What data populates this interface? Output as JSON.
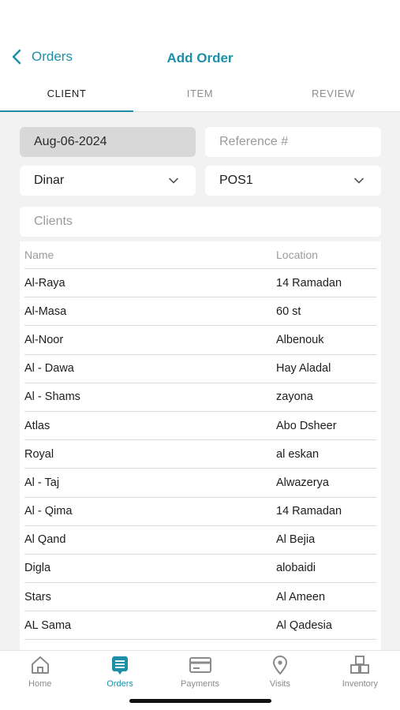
{
  "nav": {
    "back_label": "Orders",
    "title": "Add Order"
  },
  "tabs": [
    "CLIENT",
    "ITEM",
    "REVIEW"
  ],
  "form": {
    "date": "Aug-06-2024",
    "reference_placeholder": "Reference #",
    "currency": "Dinar",
    "pos": "POS1",
    "clients_placeholder": "Clients"
  },
  "table": {
    "headers": {
      "name": "Name",
      "location": "Location"
    },
    "rows": [
      {
        "name": "Al-Raya",
        "location": "14 Ramadan"
      },
      {
        "name": "Al-Masa",
        "location": "60 st"
      },
      {
        "name": "Al-Noor",
        "location": "Albenouk"
      },
      {
        "name": "Al - Dawa",
        "location": "Hay Aladal"
      },
      {
        "name": "Al - Shams",
        "location": "zayona"
      },
      {
        "name": "Atlas",
        "location": "Abo Dsheer"
      },
      {
        "name": "Royal",
        "location": "al eskan"
      },
      {
        "name": "Al - Taj",
        "location": "Alwazerya"
      },
      {
        "name": "Al - Qima",
        "location": "14 Ramadan"
      },
      {
        "name": "Al Qand",
        "location": "Al Bejia"
      },
      {
        "name": "Digla",
        "location": "alobaidi"
      },
      {
        "name": "Stars",
        "location": "Al Ameen"
      },
      {
        "name": "AL Sama",
        "location": "Al Qadesia"
      }
    ]
  },
  "tabbar": [
    {
      "label": "Home",
      "icon": "home-icon"
    },
    {
      "label": "Orders",
      "icon": "orders-icon",
      "active": true
    },
    {
      "label": "Payments",
      "icon": "card-icon"
    },
    {
      "label": "Visits",
      "icon": "location-pin-icon"
    },
    {
      "label": "Inventory",
      "icon": "boxes-icon"
    }
  ],
  "colors": {
    "accent": "#1f8fa8",
    "background": "#f2f2f2",
    "inactive": "#8a8a8a"
  }
}
